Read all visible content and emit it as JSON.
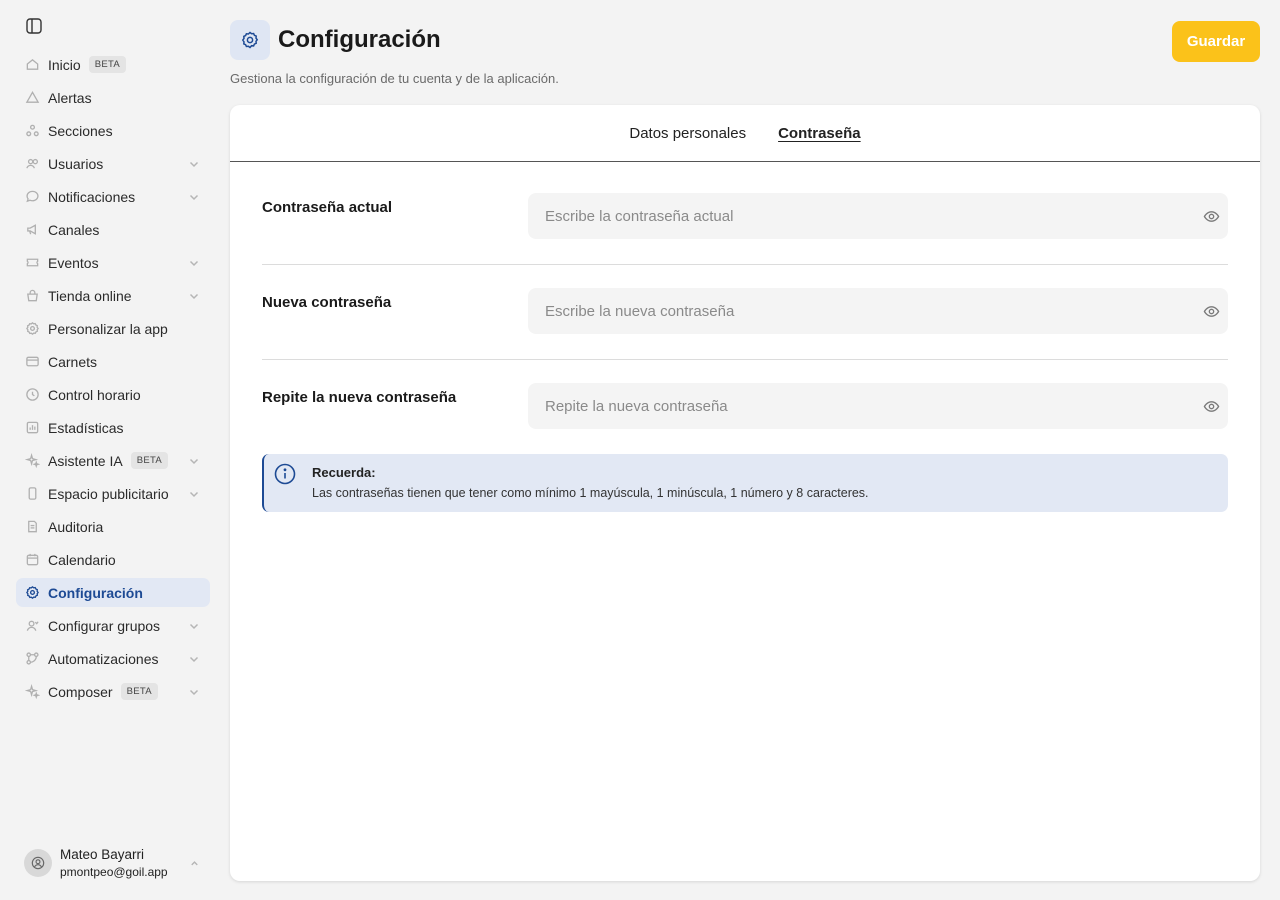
{
  "sidebar": {
    "items": [
      {
        "label": "Inicio",
        "badge": "BETA",
        "icon": "home-icon"
      },
      {
        "label": "Alertas",
        "icon": "alert-icon"
      },
      {
        "label": "Secciones",
        "icon": "sections-icon"
      },
      {
        "label": "Usuarios",
        "icon": "users-icon",
        "expandable": true
      },
      {
        "label": "Notificaciones",
        "icon": "chat-icon",
        "expandable": true
      },
      {
        "label": "Canales",
        "icon": "megaphone-icon"
      },
      {
        "label": "Eventos",
        "icon": "ticket-icon",
        "expandable": true
      },
      {
        "label": "Tienda online",
        "icon": "shop-icon",
        "expandable": true
      },
      {
        "label": "Personalizar la app",
        "icon": "settings-icon"
      },
      {
        "label": "Carnets",
        "icon": "card-icon"
      },
      {
        "label": "Control horario",
        "icon": "clock-icon"
      },
      {
        "label": "Estadísticas",
        "icon": "chart-icon"
      },
      {
        "label": "Asistente IA",
        "badge": "BETA",
        "icon": "sparkle-icon",
        "expandable": true
      },
      {
        "label": "Espacio publicitario",
        "icon": "phone-icon",
        "expandable": true
      },
      {
        "label": "Auditoria",
        "icon": "document-icon"
      },
      {
        "label": "Calendario",
        "icon": "calendar-icon"
      },
      {
        "label": "Configuración",
        "icon": "gear-icon",
        "active": true
      },
      {
        "label": "Configurar grupos",
        "icon": "user-group-icon",
        "expandable": true
      },
      {
        "label": "Automatizaciones",
        "icon": "workflow-icon",
        "expandable": true
      },
      {
        "label": "Composer",
        "badge": "BETA",
        "icon": "sparkle-icon",
        "expandable": true
      }
    ]
  },
  "user": {
    "name": "Mateo Bayarri",
    "email": "pmontpeo@goil.app"
  },
  "header": {
    "title": "Configuración",
    "subtitle": "Gestiona la configuración de tu cuenta y de la aplicación.",
    "save_label": "Guardar"
  },
  "tabs": [
    {
      "label": "Datos personales",
      "active": false
    },
    {
      "label": "Contraseña",
      "active": true
    }
  ],
  "form": {
    "current": {
      "label": "Contraseña actual",
      "placeholder": "Escribe la contraseña actual"
    },
    "new": {
      "label": "Nueva contraseña",
      "placeholder": "Escribe la nueva contraseña"
    },
    "repeat": {
      "label": "Repite la nueva contraseña",
      "placeholder": "Repite la nueva contraseña"
    }
  },
  "info": {
    "title": "Recuerda:",
    "text": "Las contraseñas tienen que tener como mínimo 1 mayúscula, 1 minúscula, 1 número y 8 caracteres."
  },
  "colors": {
    "accent": "#1d4a94",
    "save": "#fbc21a",
    "active_bg": "#e2e8f4"
  }
}
